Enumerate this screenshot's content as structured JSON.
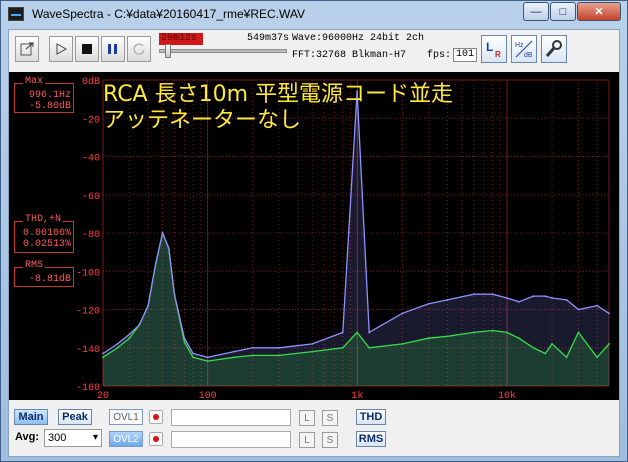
{
  "window": {
    "title": "WaveSpectra - C:¥data¥20160417_rme¥REC.WAV",
    "min_label": "—",
    "max_label": "□",
    "close_label": "✕"
  },
  "toolbar": {
    "position_time": "29m12s",
    "total_time": "549m37s",
    "wave_info": "Wave:96000Hz 24bit 2ch",
    "fft_info": "FFT:32768 Blkman-H7",
    "fps_label": "fps:",
    "fps_value": "101",
    "position_fraction": 0.053
  },
  "readouts": {
    "max_label": "Max",
    "max_freq": "996.1Hz",
    "max_db": "-5.80dB",
    "thd_label": "THD,+N",
    "thd_value": "0.00106%",
    "thdn_value": "0.02513%",
    "rms_label": "RMS",
    "rms_value": "-8.81dB"
  },
  "annotation": {
    "line1": "RCA 長さ10m 平型電源コード並走",
    "line2": "アッテネーターなし"
  },
  "chart_data": {
    "type": "line",
    "x_scale": "log",
    "xlim": [
      20,
      48000
    ],
    "ylim": [
      -160,
      0
    ],
    "y_ticks": [
      "0dB",
      "-20",
      "-40",
      "-60",
      "-80",
      "-100",
      "-120",
      "-140",
      "-160"
    ],
    "x_ticks": [
      "20",
      "100",
      "1k",
      "10k"
    ],
    "grid": true,
    "colors": {
      "left_channel": "#9090ff",
      "right_channel": "#22ee22",
      "grid": "#7a1a1a",
      "tick_text": "#ff4040"
    },
    "series": [
      {
        "color": "#9090ff",
        "x": [
          20,
          25,
          30,
          35,
          40,
          45,
          50,
          55,
          60,
          70,
          80,
          100,
          150,
          200,
          300,
          500,
          800,
          996,
          1200,
          2000,
          3000,
          4000,
          6000,
          8000,
          10000,
          12000,
          15000,
          18000,
          20000,
          25000,
          30000,
          40000,
          48000
        ],
        "y": [
          -143,
          -138,
          -133,
          -128,
          -118,
          -96,
          -80,
          -88,
          -112,
          -135,
          -143,
          -145,
          -142,
          -140,
          -140,
          -138,
          -132,
          -5.8,
          -132,
          -122,
          -117,
          -115,
          -112,
          -112,
          -114,
          -116,
          -113,
          -113,
          -114,
          -115,
          -120,
          -118,
          -122
        ]
      },
      {
        "color": "#22ee22",
        "x": [
          20,
          25,
          30,
          35,
          40,
          45,
          50,
          55,
          60,
          70,
          80,
          100,
          150,
          200,
          300,
          500,
          800,
          996,
          1200,
          2000,
          3000,
          4000,
          6000,
          8000,
          10000,
          12000,
          15000,
          18000,
          20000,
          25000,
          30000,
          40000,
          48000
        ],
        "y": [
          -145,
          -140,
          -135,
          -128,
          -118,
          -96,
          -80,
          -88,
          -112,
          -137,
          -145,
          -147,
          -145,
          -144,
          -144,
          -142,
          -140,
          -132,
          -140,
          -138,
          -135,
          -134,
          -132,
          -131,
          -132,
          -135,
          -140,
          -143,
          -138,
          -145,
          -132,
          -145,
          -138
        ]
      }
    ]
  },
  "bottom": {
    "main_label": "Main",
    "peak_label": "Peak",
    "ovl1_label": "OVL1",
    "ovl2_label": "OVL2",
    "l_label": "L",
    "s_label": "S",
    "thd_button": "THD",
    "rms_button": "RMS",
    "avg_label": "Avg:",
    "avg_value": "300"
  }
}
